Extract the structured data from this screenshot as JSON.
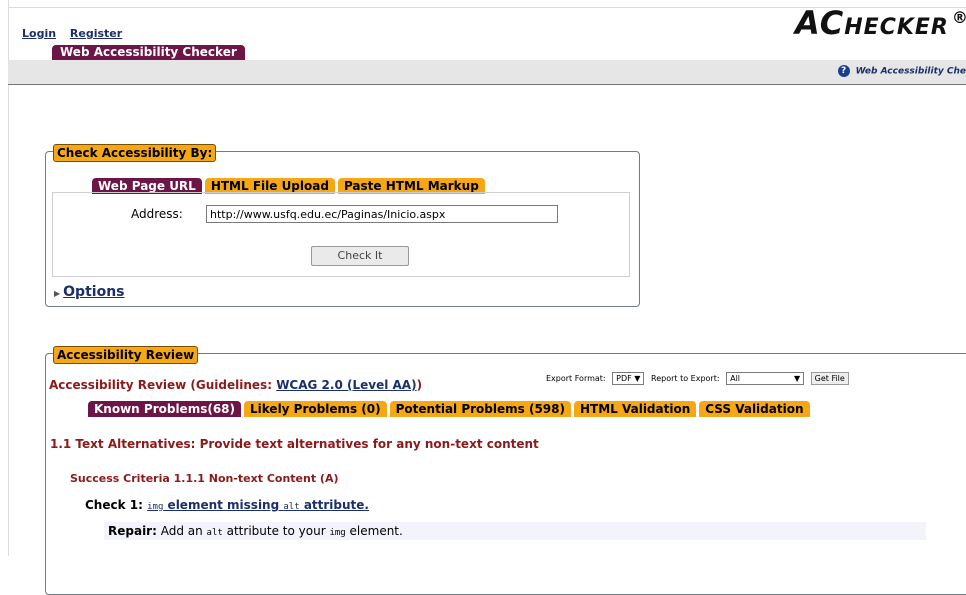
{
  "auth": {
    "login": "Login",
    "register": "Register"
  },
  "site_tab": "Web Accessibility Checker",
  "logo": {
    "big": "AC",
    "small": "HECKER",
    "reg": "®"
  },
  "nav_right": "Web Accessibility Che",
  "check_box": {
    "legend": "Check Accessibility By:",
    "tabs": [
      "Web Page URL",
      "HTML File Upload",
      "Paste HTML Markup"
    ],
    "address_label": "Address:",
    "address_value": "http://www.usfq.edu.ec/Paginas/Inicio.aspx",
    "check_button": "Check It",
    "options": "Options"
  },
  "review": {
    "legend": "Accessibility Review",
    "export_format_label": "Export Format:",
    "export_format_value": "PDF",
    "report_label": "Report to Export:",
    "report_value": "All",
    "get_file": "Get File",
    "title_prefix": "Accessibility Review (Guidelines: ",
    "guidelines": "WCAG 2.0 (Level AA)",
    "title_suffix": ")",
    "tabs": [
      "Known Problems(68)",
      "Likely Problems (0)",
      "Potential Problems (598)",
      "HTML Validation",
      "CSS Validation"
    ],
    "section": "1.1 Text Alternatives: Provide text alternatives for any non-text content",
    "criteria": "Success Criteria 1.1.1 Non-text Content (A)",
    "check_label": "Check 1:",
    "check_code": "img",
    "check_text": " element missing ",
    "check_code2": "alt",
    "check_text2": " attribute.",
    "repair_label": "Repair:",
    "repair_text1": " Add an ",
    "repair_code1": "alt",
    "repair_text2": " attribute to your ",
    "repair_code2": "img",
    "repair_text3": " element."
  },
  "colors": {
    "maroon": "#6d1546",
    "orange": "#f5a716",
    "link": "#1b2f6b",
    "heading_red": "#8b1a1a"
  }
}
